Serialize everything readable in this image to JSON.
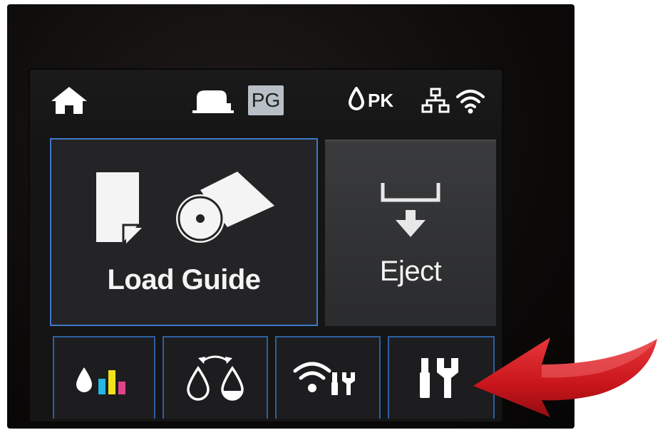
{
  "status_bar": {
    "icons": [
      "home-icon",
      "paper-sheet-icon",
      "ink-drop-icon",
      "wired-network-icon",
      "wifi-icon"
    ],
    "paper_type_badge": "PG",
    "black_ink_label": "PK"
  },
  "main": {
    "load_guide": {
      "label": "Load Guide",
      "icons": [
        "cut-sheet-icon",
        "roll-paper-icon"
      ]
    },
    "eject": {
      "label": "Eject",
      "icons": [
        "eject-arrow-icon"
      ]
    }
  },
  "bottom_bar": {
    "buttons": [
      {
        "name": "ink-levels-button",
        "icons": [
          "ink-drop-icon",
          "ink-level-bars-icon"
        ]
      },
      {
        "name": "replace-ink-button",
        "icons": [
          "swap-drops-icon"
        ]
      },
      {
        "name": "wifi-setup-button",
        "icons": [
          "wifi-icon",
          "tools-icon"
        ]
      },
      {
        "name": "setup-button",
        "icons": [
          "tools-icon"
        ]
      }
    ]
  },
  "colors": {
    "screen_bg": "#151515",
    "tile_border": "#3e78c9",
    "arrow": "#d41a1f",
    "ink_cyan": "#27b7e4",
    "ink_yellow": "#f2e21a",
    "ink_magenta": "#e2428a"
  }
}
